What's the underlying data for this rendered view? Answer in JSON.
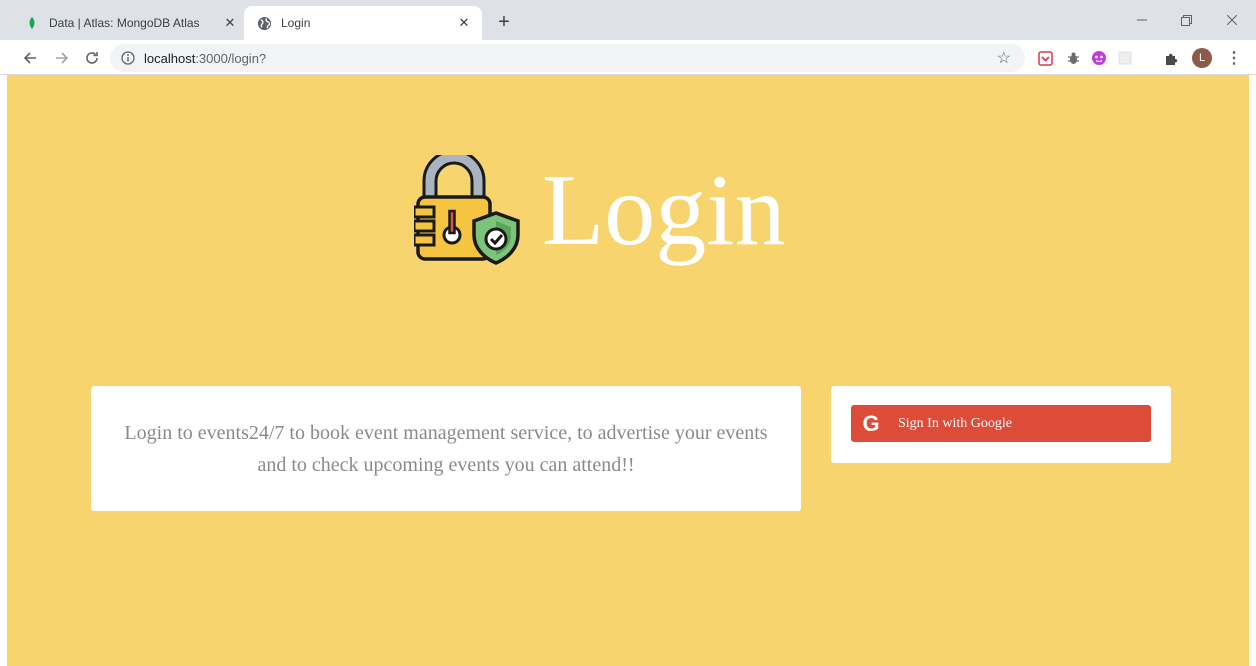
{
  "tabs": [
    {
      "title": "Data | Atlas: MongoDB Atlas",
      "favicon": "leaf-icon",
      "active": false
    },
    {
      "title": "Login",
      "favicon": "globe-icon",
      "active": true
    }
  ],
  "toolbar": {
    "url_host": "localhost",
    "url_path": ":3000/login?"
  },
  "profile": {
    "initial": "L"
  },
  "page": {
    "title": "Login",
    "description": "Login to events24/7 to book event management service, to advertise your events and to check upcoming events you can attend!!",
    "google_icon": "G",
    "google_button_label": "Sign In with Google"
  },
  "colors": {
    "background": "#f7d46e",
    "google_button": "#dd4b39",
    "description_text": "#8a8a8a"
  }
}
